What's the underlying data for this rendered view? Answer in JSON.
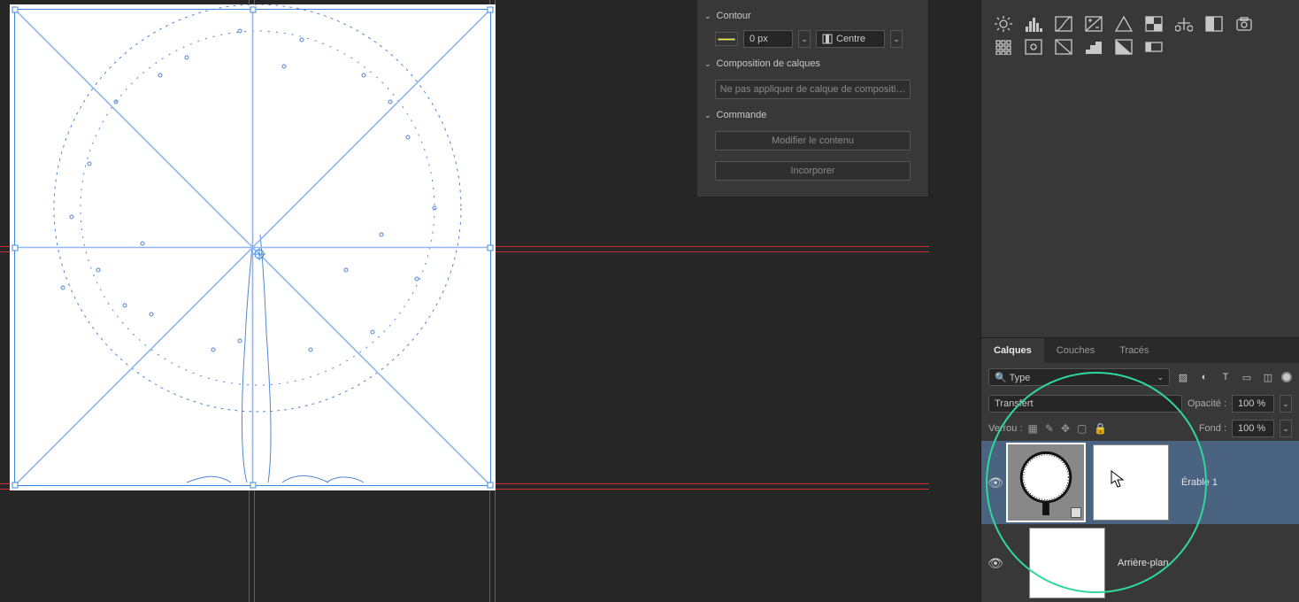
{
  "properties": {
    "sections": {
      "contour": "Contour",
      "composition": "Composition de calques",
      "commande": "Commande"
    },
    "stroke_value": "0 px",
    "stroke_align": "Centre",
    "composition_btn": "Ne pas appliquer de calque de compositi…",
    "cmd_edit": "Modifier le contenu",
    "cmd_embed": "Incorporer"
  },
  "layers_panel": {
    "tabs": [
      "Calques",
      "Couches",
      "Tracés"
    ],
    "active_tab": 0,
    "type_filter": "Type",
    "type_filter_icon": "🔍",
    "opacity_label": "Opacité :",
    "opacity_value": "100 %",
    "blend_mode": "Transfert",
    "lock_label": "Verrou :",
    "fill_label": "Fond :",
    "fill_value": "100 %",
    "layers": [
      {
        "name": "Érable 1",
        "selected": true,
        "has_mask": true,
        "smart_object": true
      },
      {
        "name": "Arrière-plan",
        "selected": false
      }
    ]
  }
}
